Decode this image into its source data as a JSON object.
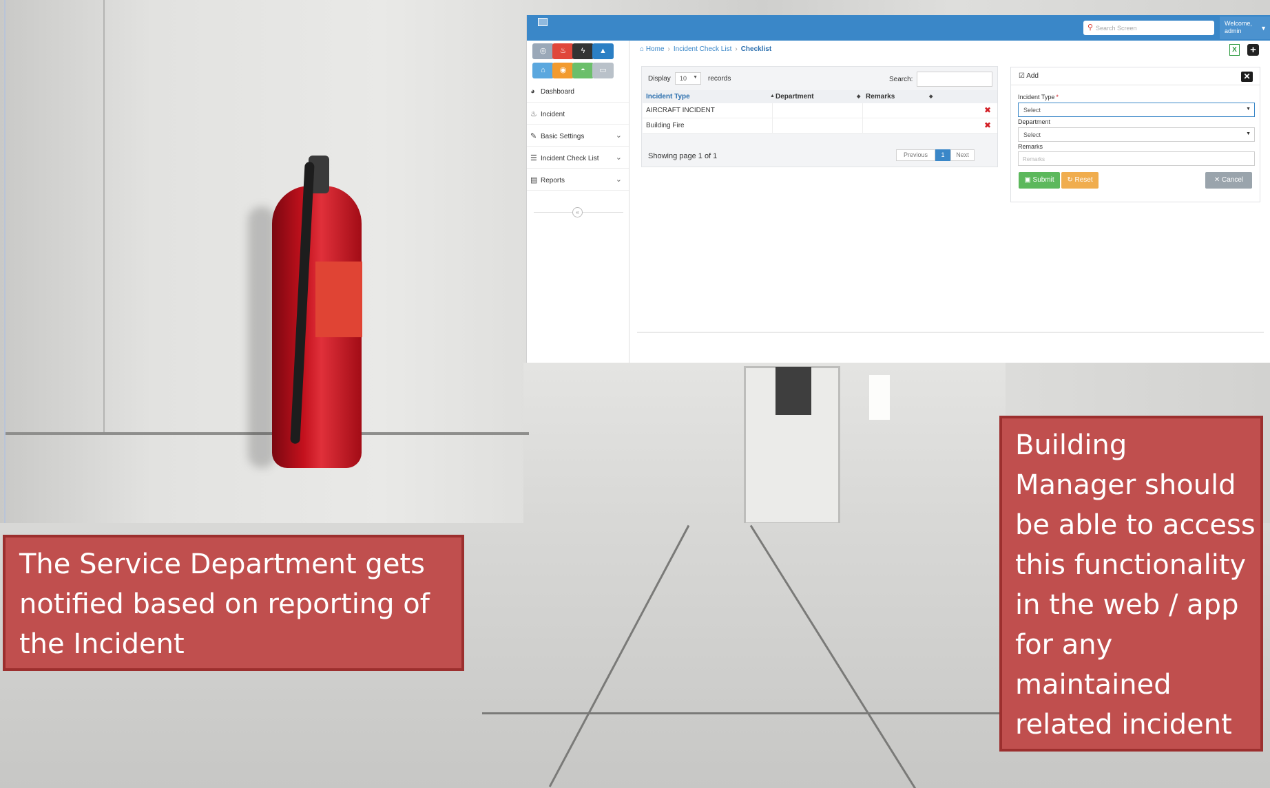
{
  "app": {
    "search_placeholder": "Search Screen",
    "welcome_line1": "Welcome,",
    "welcome_line2": "admin"
  },
  "sidebar": {
    "tiles": [
      {
        "icon": "dashboard-gauge-icon",
        "glyph": "◎",
        "color": "#9aa8b8"
      },
      {
        "icon": "fire-icon",
        "glyph": "♨",
        "color": "#e0463a"
      },
      {
        "icon": "lightning-icon",
        "glyph": "ϟ",
        "color": "#333333"
      },
      {
        "icon": "warning-icon",
        "glyph": "▲",
        "color": "#2b7fc4"
      },
      {
        "icon": "bank-icon",
        "glyph": "⌂",
        "color": "#5aa7de"
      },
      {
        "icon": "target-icon",
        "glyph": "◉",
        "color": "#f29a2e"
      },
      {
        "icon": "car-icon",
        "glyph": "◓",
        "color": "#6bbf6a"
      },
      {
        "icon": "laptop-icon",
        "glyph": "▭",
        "color": "#b9c1c9"
      }
    ],
    "items": [
      {
        "label": "Dashboard",
        "icon": "dashboard-icon",
        "glyph": "◕",
        "has_submenu": false
      },
      {
        "label": "Incident",
        "icon": "fire-icon",
        "glyph": "♨",
        "has_submenu": false
      },
      {
        "label": "Basic Settings",
        "icon": "wrench-icon",
        "glyph": "✎",
        "has_submenu": true
      },
      {
        "label": "Incident Check List",
        "icon": "list-icon",
        "glyph": "☰",
        "has_submenu": true
      },
      {
        "label": "Reports",
        "icon": "report-icon",
        "glyph": "▤",
        "has_submenu": true
      }
    ]
  },
  "breadcrumb": {
    "home": "Home",
    "section": "Incident Check List",
    "current": "Checklist"
  },
  "table": {
    "display_label": "Display",
    "page_size": "10",
    "records_label": "records",
    "search_label": "Search:",
    "columns": [
      "Incident Type",
      "Department",
      "Remarks"
    ],
    "rows": [
      {
        "incident_type": "AIRCRAFT INCIDENT",
        "department": "",
        "remarks": ""
      },
      {
        "incident_type": "Building Fire",
        "department": "",
        "remarks": ""
      }
    ],
    "page_info": "Showing page 1 of 1",
    "pager": {
      "previous": "Previous",
      "current": "1",
      "next": "Next"
    }
  },
  "form": {
    "title": "Add",
    "incident_type_label": "Incident Type",
    "required_mark": "*",
    "incident_type_value": "Select",
    "department_label": "Department",
    "department_value": "Select",
    "remarks_label": "Remarks",
    "remarks_placeholder": "Remarks",
    "submit_label": "Submit",
    "reset_label": "Reset",
    "cancel_label": "Cancel",
    "colors": {
      "submit": "#5cb85c",
      "reset": "#f0ad4e",
      "cancel": "#9aa4ac"
    }
  },
  "callouts": {
    "left_lines": [
      "The Service Department gets",
      "notified based on  reporting of",
      "the Incident"
    ],
    "right_lines": [
      "Building",
      "Manager should",
      "be able to access",
      "this functionality",
      "in the web / app",
      "for any",
      "maintained",
      "related incident"
    ]
  },
  "colors": {
    "topbar": "#3a87c8",
    "callout": "#c04f4e",
    "delete": "#d31f26"
  }
}
